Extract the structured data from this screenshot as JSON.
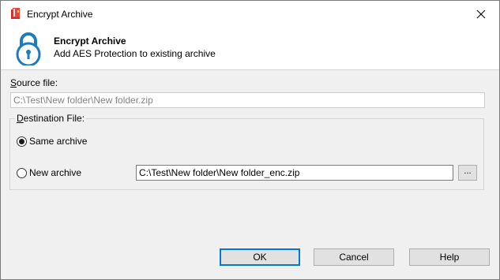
{
  "window": {
    "title": "Encrypt Archive"
  },
  "header": {
    "title": "Encrypt Archive",
    "subtitle": "Add AES Protection to existing archive",
    "icon": "lock-icon"
  },
  "source": {
    "label": "Source file:",
    "value": "C:\\Test\\New folder\\New folder.zip"
  },
  "destination": {
    "legend": "Destination File:",
    "same_archive_label": "Same archive",
    "same_archive_selected": true,
    "new_archive_label": "New archive",
    "new_archive_selected": false,
    "new_archive_value": "C:\\Test\\New folder\\New folder_enc.zip",
    "browse_label": "..."
  },
  "buttons": {
    "ok": "OK",
    "cancel": "Cancel",
    "help": "Help"
  },
  "colors": {
    "accent": "#0078d7",
    "lock_icon": "#1e7bc0",
    "app_icon_red": "#c8312b"
  }
}
